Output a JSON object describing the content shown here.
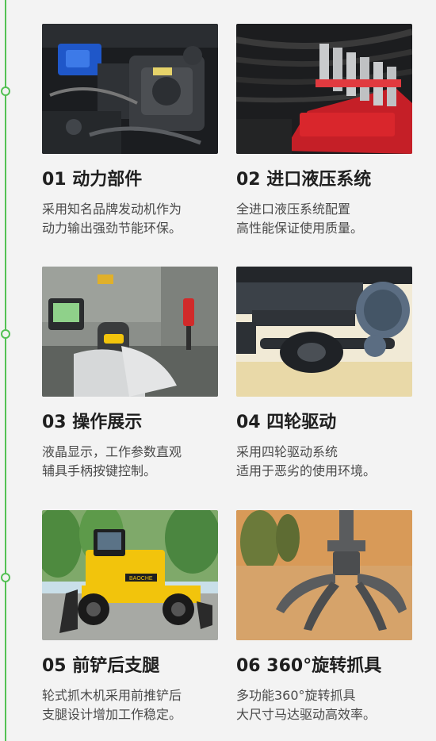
{
  "features": [
    {
      "title": "01 动力部件",
      "lines": [
        "采用知名品牌发动机作为",
        "动力输出强劲节能环保。"
      ]
    },
    {
      "title": "02 进口液压系统",
      "lines": [
        "全进口液压系统配置",
        "高性能保证使用质量。"
      ]
    },
    {
      "title": "03 操作展示",
      "lines": [
        "液晶显示，工作参数直观",
        "辅具手柄按键控制。"
      ]
    },
    {
      "title": "04 四轮驱动",
      "lines": [
        "采用四轮驱动系统",
        "适用于恶劣的使用环境。"
      ]
    },
    {
      "title": "05 前铲后支腿",
      "lines": [
        "轮式抓木机采用前推铲后",
        "支腿设计增加工作稳定。"
      ]
    },
    {
      "title": "06 360°旋转抓具",
      "lines": [
        "多功能360°旋转抓具",
        "大尺寸马达驱动高效率。"
      ]
    }
  ],
  "machine_badge": "BAOCHE",
  "colors": {
    "accent_green": "#54c154",
    "machine_yellow": "#f2c40c",
    "hydraulic_red": "#d9262c"
  }
}
